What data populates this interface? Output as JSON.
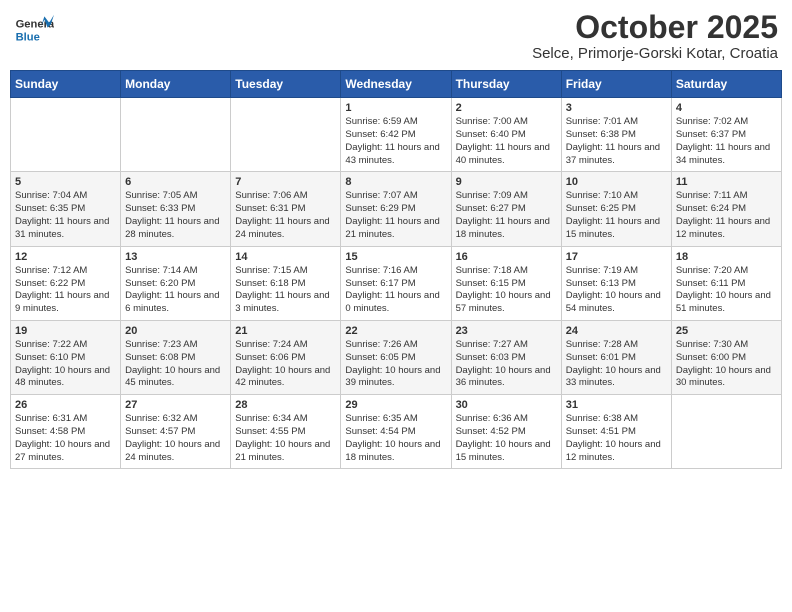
{
  "header": {
    "logo_line1": "General",
    "logo_line2": "Blue",
    "title": "October 2025",
    "subtitle": "Selce, Primorje-Gorski Kotar, Croatia"
  },
  "weekdays": [
    "Sunday",
    "Monday",
    "Tuesday",
    "Wednesday",
    "Thursday",
    "Friday",
    "Saturday"
  ],
  "weeks": [
    [
      {
        "day": "",
        "sunrise": "",
        "sunset": "",
        "daylight": ""
      },
      {
        "day": "",
        "sunrise": "",
        "sunset": "",
        "daylight": ""
      },
      {
        "day": "",
        "sunrise": "",
        "sunset": "",
        "daylight": ""
      },
      {
        "day": "1",
        "sunrise": "Sunrise: 6:59 AM",
        "sunset": "Sunset: 6:42 PM",
        "daylight": "Daylight: 11 hours and 43 minutes."
      },
      {
        "day": "2",
        "sunrise": "Sunrise: 7:00 AM",
        "sunset": "Sunset: 6:40 PM",
        "daylight": "Daylight: 11 hours and 40 minutes."
      },
      {
        "day": "3",
        "sunrise": "Sunrise: 7:01 AM",
        "sunset": "Sunset: 6:38 PM",
        "daylight": "Daylight: 11 hours and 37 minutes."
      },
      {
        "day": "4",
        "sunrise": "Sunrise: 7:02 AM",
        "sunset": "Sunset: 6:37 PM",
        "daylight": "Daylight: 11 hours and 34 minutes."
      }
    ],
    [
      {
        "day": "5",
        "sunrise": "Sunrise: 7:04 AM",
        "sunset": "Sunset: 6:35 PM",
        "daylight": "Daylight: 11 hours and 31 minutes."
      },
      {
        "day": "6",
        "sunrise": "Sunrise: 7:05 AM",
        "sunset": "Sunset: 6:33 PM",
        "daylight": "Daylight: 11 hours and 28 minutes."
      },
      {
        "day": "7",
        "sunrise": "Sunrise: 7:06 AM",
        "sunset": "Sunset: 6:31 PM",
        "daylight": "Daylight: 11 hours and 24 minutes."
      },
      {
        "day": "8",
        "sunrise": "Sunrise: 7:07 AM",
        "sunset": "Sunset: 6:29 PM",
        "daylight": "Daylight: 11 hours and 21 minutes."
      },
      {
        "day": "9",
        "sunrise": "Sunrise: 7:09 AM",
        "sunset": "Sunset: 6:27 PM",
        "daylight": "Daylight: 11 hours and 18 minutes."
      },
      {
        "day": "10",
        "sunrise": "Sunrise: 7:10 AM",
        "sunset": "Sunset: 6:25 PM",
        "daylight": "Daylight: 11 hours and 15 minutes."
      },
      {
        "day": "11",
        "sunrise": "Sunrise: 7:11 AM",
        "sunset": "Sunset: 6:24 PM",
        "daylight": "Daylight: 11 hours and 12 minutes."
      }
    ],
    [
      {
        "day": "12",
        "sunrise": "Sunrise: 7:12 AM",
        "sunset": "Sunset: 6:22 PM",
        "daylight": "Daylight: 11 hours and 9 minutes."
      },
      {
        "day": "13",
        "sunrise": "Sunrise: 7:14 AM",
        "sunset": "Sunset: 6:20 PM",
        "daylight": "Daylight: 11 hours and 6 minutes."
      },
      {
        "day": "14",
        "sunrise": "Sunrise: 7:15 AM",
        "sunset": "Sunset: 6:18 PM",
        "daylight": "Daylight: 11 hours and 3 minutes."
      },
      {
        "day": "15",
        "sunrise": "Sunrise: 7:16 AM",
        "sunset": "Sunset: 6:17 PM",
        "daylight": "Daylight: 11 hours and 0 minutes."
      },
      {
        "day": "16",
        "sunrise": "Sunrise: 7:18 AM",
        "sunset": "Sunset: 6:15 PM",
        "daylight": "Daylight: 10 hours and 57 minutes."
      },
      {
        "day": "17",
        "sunrise": "Sunrise: 7:19 AM",
        "sunset": "Sunset: 6:13 PM",
        "daylight": "Daylight: 10 hours and 54 minutes."
      },
      {
        "day": "18",
        "sunrise": "Sunrise: 7:20 AM",
        "sunset": "Sunset: 6:11 PM",
        "daylight": "Daylight: 10 hours and 51 minutes."
      }
    ],
    [
      {
        "day": "19",
        "sunrise": "Sunrise: 7:22 AM",
        "sunset": "Sunset: 6:10 PM",
        "daylight": "Daylight: 10 hours and 48 minutes."
      },
      {
        "day": "20",
        "sunrise": "Sunrise: 7:23 AM",
        "sunset": "Sunset: 6:08 PM",
        "daylight": "Daylight: 10 hours and 45 minutes."
      },
      {
        "day": "21",
        "sunrise": "Sunrise: 7:24 AM",
        "sunset": "Sunset: 6:06 PM",
        "daylight": "Daylight: 10 hours and 42 minutes."
      },
      {
        "day": "22",
        "sunrise": "Sunrise: 7:26 AM",
        "sunset": "Sunset: 6:05 PM",
        "daylight": "Daylight: 10 hours and 39 minutes."
      },
      {
        "day": "23",
        "sunrise": "Sunrise: 7:27 AM",
        "sunset": "Sunset: 6:03 PM",
        "daylight": "Daylight: 10 hours and 36 minutes."
      },
      {
        "day": "24",
        "sunrise": "Sunrise: 7:28 AM",
        "sunset": "Sunset: 6:01 PM",
        "daylight": "Daylight: 10 hours and 33 minutes."
      },
      {
        "day": "25",
        "sunrise": "Sunrise: 7:30 AM",
        "sunset": "Sunset: 6:00 PM",
        "daylight": "Daylight: 10 hours and 30 minutes."
      }
    ],
    [
      {
        "day": "26",
        "sunrise": "Sunrise: 6:31 AM",
        "sunset": "Sunset: 4:58 PM",
        "daylight": "Daylight: 10 hours and 27 minutes."
      },
      {
        "day": "27",
        "sunrise": "Sunrise: 6:32 AM",
        "sunset": "Sunset: 4:57 PM",
        "daylight": "Daylight: 10 hours and 24 minutes."
      },
      {
        "day": "28",
        "sunrise": "Sunrise: 6:34 AM",
        "sunset": "Sunset: 4:55 PM",
        "daylight": "Daylight: 10 hours and 21 minutes."
      },
      {
        "day": "29",
        "sunrise": "Sunrise: 6:35 AM",
        "sunset": "Sunset: 4:54 PM",
        "daylight": "Daylight: 10 hours and 18 minutes."
      },
      {
        "day": "30",
        "sunrise": "Sunrise: 6:36 AM",
        "sunset": "Sunset: 4:52 PM",
        "daylight": "Daylight: 10 hours and 15 minutes."
      },
      {
        "day": "31",
        "sunrise": "Sunrise: 6:38 AM",
        "sunset": "Sunset: 4:51 PM",
        "daylight": "Daylight: 10 hours and 12 minutes."
      },
      {
        "day": "",
        "sunrise": "",
        "sunset": "",
        "daylight": ""
      }
    ]
  ]
}
